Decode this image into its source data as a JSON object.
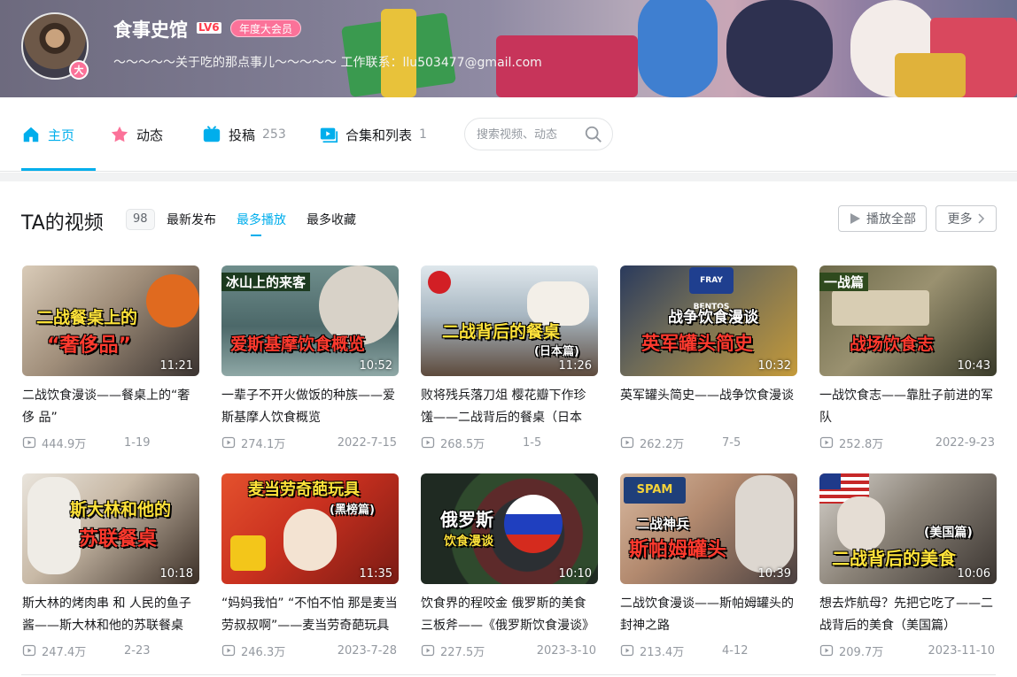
{
  "header": {
    "username": "食事史馆",
    "level": "LV6",
    "vip_label": "年度大会员",
    "avatar_badge": "大",
    "signature": "～～～～～关于吃的那点事儿～～～～～ 工作联系：llu503477@gmail.com"
  },
  "nav": {
    "home": "主页",
    "dynamic": "动态",
    "posts": "投稿",
    "posts_count": "253",
    "collections": "合集和列表",
    "collections_count": "1",
    "search_placeholder": "搜索视频、动态"
  },
  "videos_section": {
    "title": "TA的视频",
    "count": "98",
    "sort_options": [
      "最新发布",
      "最多播放",
      "最多收藏"
    ],
    "active_sort": "最多播放",
    "play_all": "播放全部",
    "more": "更多"
  },
  "videos": [
    {
      "title": "二战饮食漫谈——餐桌上的“奢 侈 品”",
      "duration": "11:21",
      "views": "444.9万",
      "date": "1-19",
      "caption_line1": "二战餐桌上的",
      "caption_line2": "“奢侈品”"
    },
    {
      "title": "一辈子不开火做饭的种族——爱斯基摩人饮食概览",
      "duration": "10:52",
      "views": "274.1万",
      "date": "2022-7-15",
      "tag": "冰山上的来客",
      "caption_line1": "爱斯基摩饮食概览"
    },
    {
      "title": "败将残兵落刀俎 樱花瓣下作珍馐——二战背后的餐桌（日本篇）",
      "duration": "11:26",
      "views": "268.5万",
      "date": "1-5",
      "caption_line1": "二战背后的餐桌",
      "caption_line2": "(日本篇)"
    },
    {
      "title": "英军罐头简史——战争饮食漫谈",
      "duration": "10:32",
      "views": "262.2万",
      "date": "7-5",
      "caption_line1": "战争饮食漫谈",
      "caption_line2": "英军罐头简史",
      "can_label": "FRAY BENTOS"
    },
    {
      "title": "一战饮食志——靠肚子前进的军队",
      "duration": "10:43",
      "views": "252.8万",
      "date": "2022-9-23",
      "tag": "一战篇",
      "caption_line1": "战场饮食志"
    },
    {
      "title": "斯大林的烤肉串 和 人民的鱼子酱——斯大林和他的苏联餐桌",
      "duration": "10:18",
      "views": "247.4万",
      "date": "2-23",
      "caption_line1": "斯大林和他的",
      "caption_line2": "苏联餐桌"
    },
    {
      "title": "“妈妈我怕” “不怕不怕 那是麦当劳叔叔啊”——麦当劳奇葩玩具（黑榜篇）",
      "duration": "11:35",
      "views": "246.3万",
      "date": "2023-7-28",
      "caption_line1": "麦当劳奇葩玩具",
      "caption_line2": "(黑榜篇)"
    },
    {
      "title": "饮食界的程咬金 俄罗斯的美食三板斧——《俄罗斯饮食漫谈》",
      "duration": "10:10",
      "views": "227.5万",
      "date": "2023-3-10",
      "caption_line1": "俄罗斯",
      "caption_line2": "饮食漫谈"
    },
    {
      "title": "二战饮食漫谈——斯帕姆罐头的封神之路",
      "duration": "10:39",
      "views": "213.4万",
      "date": "4-12",
      "caption_line1": "二战神兵",
      "caption_line2": "斯帕姆罐头",
      "can_label": "SPAM"
    },
    {
      "title": "想去炸航母？先把它吃了——二战背后的美食（美国篇）",
      "duration": "10:06",
      "views": "209.7万",
      "date": "2023-11-10",
      "caption_line1": "(美国篇)",
      "caption_line2": "二战背后的美食"
    }
  ],
  "colors": {
    "accent": "#00aeec",
    "vip": "#fb7299",
    "level": "#ff3b4c"
  }
}
